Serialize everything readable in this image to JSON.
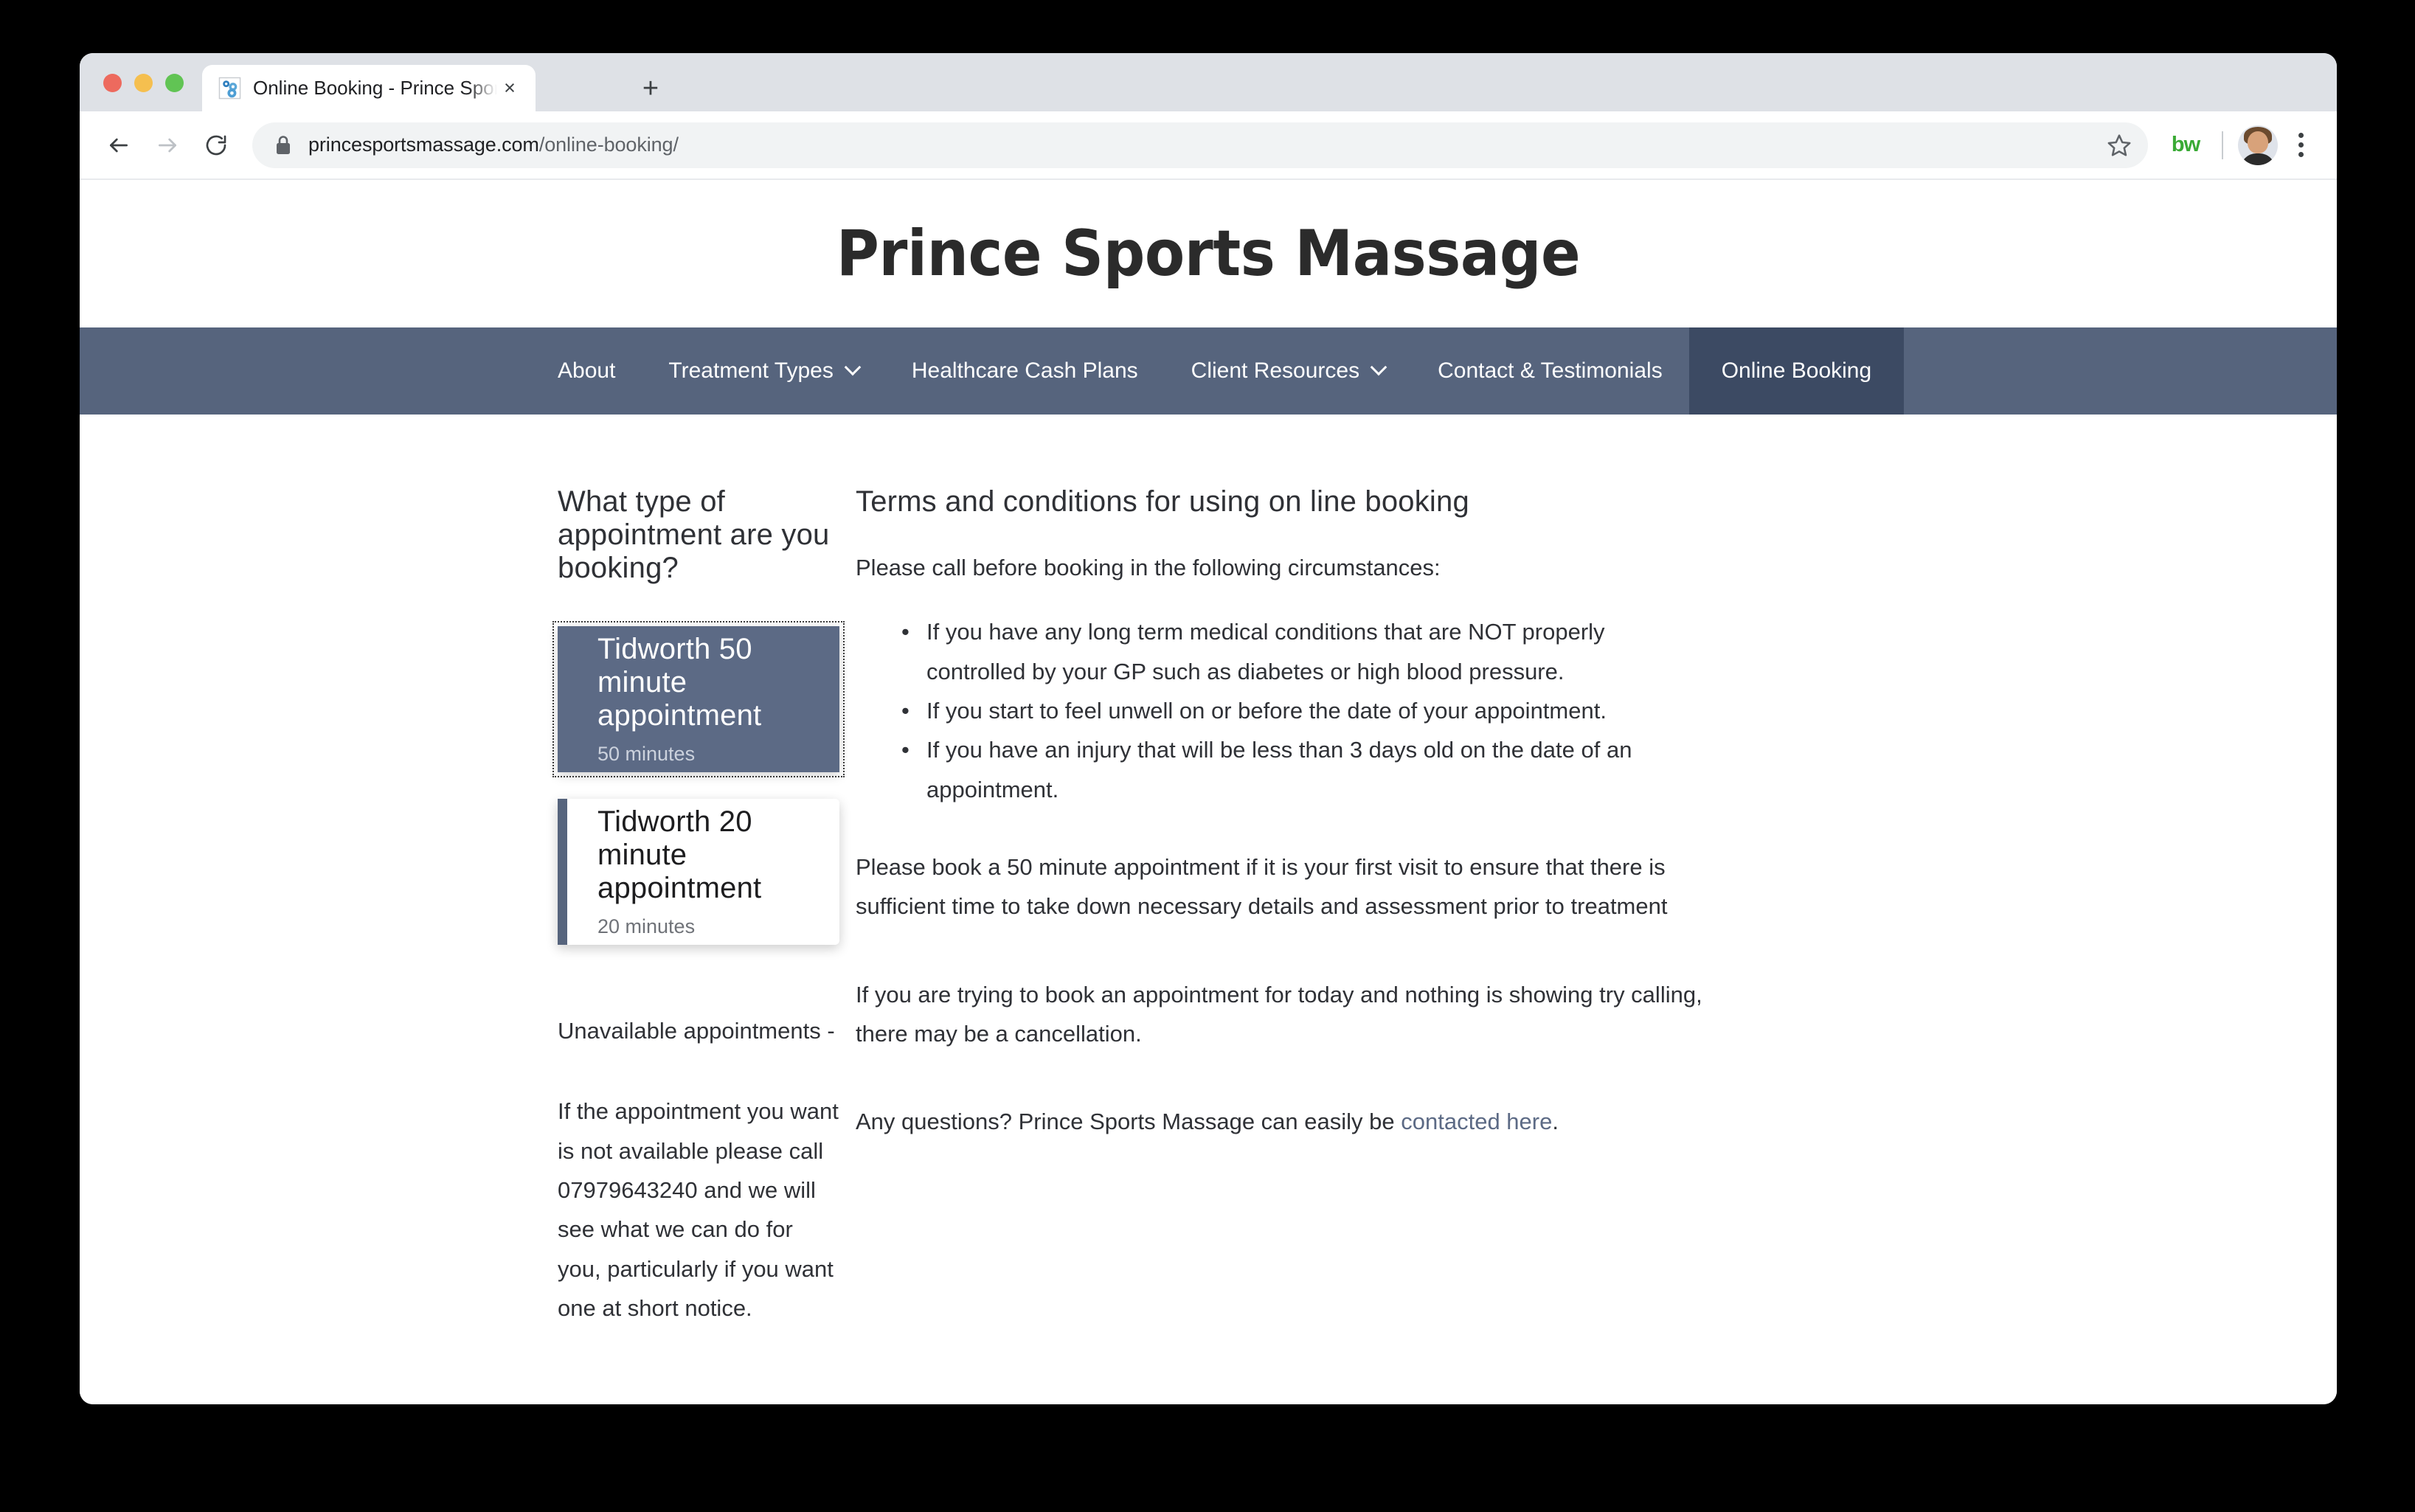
{
  "browser": {
    "tab": {
      "title": "Online Booking - Prince Sports",
      "favicon_name": "gears-icon",
      "close_label": "×"
    },
    "new_tab_label": "+",
    "back_label": "←",
    "forward_label": "→",
    "reload_label": "↻",
    "omnibox": {
      "url_domain": "princesportsmassage.com",
      "url_path": "/online-booking/",
      "lock_icon_name": "lock-icon",
      "star_icon_name": "bookmark-star-icon"
    },
    "extension_label": "bw",
    "profile_icon_name": "avatar",
    "menu_icon_name": "kebab-menu-icon"
  },
  "site": {
    "title": "Prince Sports Massage",
    "nav": [
      {
        "label": "About",
        "has_caret": false,
        "active": false
      },
      {
        "label": "Treatment Types",
        "has_caret": true,
        "active": false
      },
      {
        "label": "Healthcare Cash Plans",
        "has_caret": false,
        "active": false
      },
      {
        "label": "Client Resources",
        "has_caret": true,
        "active": false
      },
      {
        "label": "Contact & Testimonials",
        "has_caret": false,
        "active": false
      },
      {
        "label": "Online Booking",
        "has_caret": false,
        "active": true
      }
    ]
  },
  "booking": {
    "heading": "What type of appointment are you booking?",
    "options": [
      {
        "name": "Tidworth 50 minute appointment",
        "duration": "50 minutes",
        "selected": true
      },
      {
        "name": "Tidworth 20 minute appointment",
        "duration": "20 minutes",
        "selected": false
      }
    ],
    "unavailable_heading": "Unavailable appointments -",
    "unavailable_text": "If the appointment you want is not available please call 07979643240 and we will see what we can do for you, particularly if you want one at short notice.",
    "phone": "07979643240"
  },
  "terms": {
    "heading": "Terms and conditions for using on line booking",
    "intro": "Please call before booking in the following circumstances:",
    "bullets": [
      "If you have any long term medical conditions that are NOT properly controlled by your GP such as diabetes or high blood pressure.",
      "If you start to feel unwell on or before the date of your appointment.",
      "If you have an injury that will be less than 3 days old on the date of an appointment."
    ],
    "para_first_visit": "Please book a 50 minute appointment if it is your first visit to ensure that there is sufficient time to take down necessary details and assessment prior to treatment",
    "para_today": "If you are trying to book an appointment for today and nothing is showing try calling, there may be a cancellation.",
    "questions_prefix": "Any questions?  Prince Sports Massage can easily be",
    "contact_link": "contacted here",
    "contact_suffix": "."
  },
  "colors": {
    "nav_bg": "#56647d",
    "nav_active_bg": "#3c4a63",
    "card_selected_bg": "#5c6a85",
    "link": "#5c6a85",
    "extension_green": "#3aaa35"
  }
}
